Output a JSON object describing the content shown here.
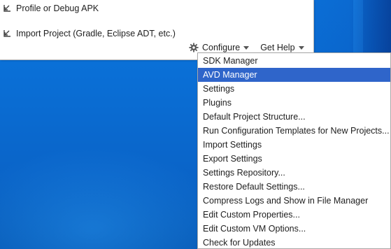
{
  "welcome": {
    "actions": [
      {
        "label": "Profile or Debug APK",
        "icon": "import-arrow-icon"
      },
      {
        "label": "Import Project (Gradle, Eclipse ADT, etc.)",
        "icon": "import-arrow-icon"
      }
    ],
    "configure_label": "Configure",
    "get_help_label": "Get Help"
  },
  "configure_menu": {
    "selected_index": 1,
    "items": [
      "SDK Manager",
      "AVD Manager",
      "Settings",
      "Plugins",
      "Default Project Structure...",
      "Run Configuration Templates for New Projects...",
      "Import Settings",
      "Export Settings",
      "Settings Repository...",
      "Restore Default Settings...",
      "Compress Logs and Show in File Manager",
      "Edit Custom Properties...",
      "Edit Custom VM Options...",
      "Check for Updates"
    ]
  },
  "colors": {
    "selection": "#2f65ca",
    "desktop": "#0a6fd6"
  }
}
